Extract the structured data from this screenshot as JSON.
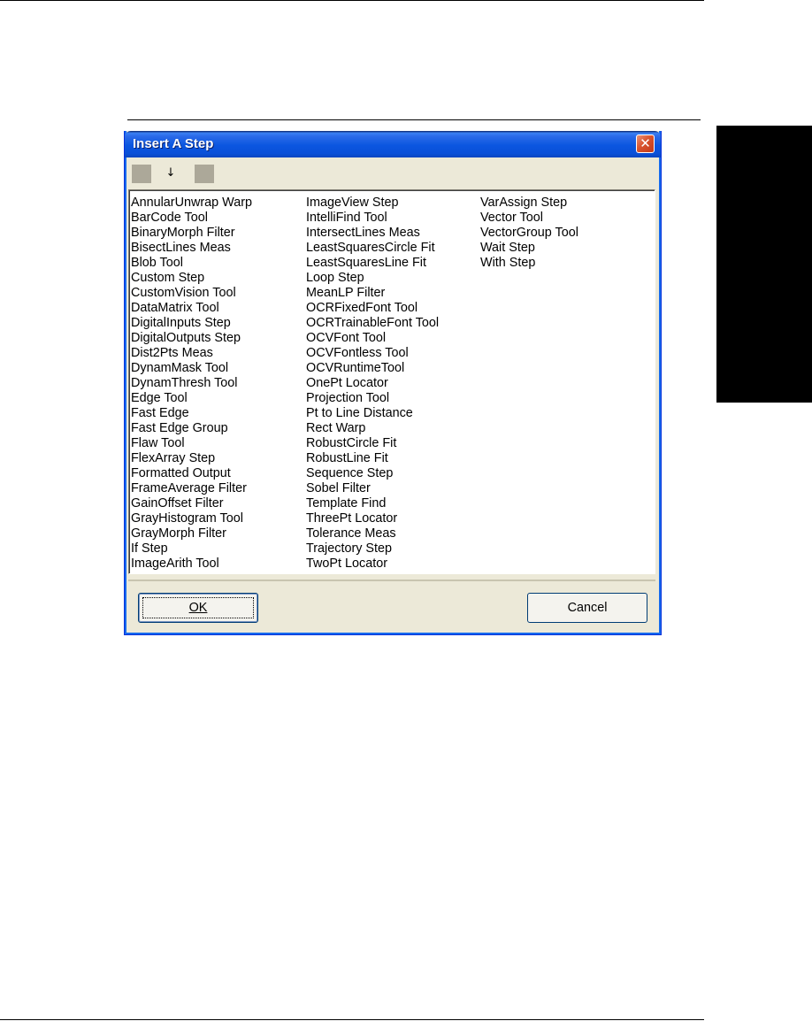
{
  "dialog": {
    "title": "Insert A Step",
    "close_glyph": "✕",
    "toolbar": {
      "down_glyph": "↓"
    },
    "ok_label": "OK",
    "cancel_label": "Cancel"
  },
  "steps": {
    "col1": [
      "AnnularUnwrap Warp",
      "BarCode Tool",
      "BinaryMorph Filter",
      "BisectLines Meas",
      "Blob Tool",
      "Custom Step",
      "CustomVision Tool",
      "DataMatrix Tool",
      "DigitalInputs Step",
      "DigitalOutputs Step",
      "Dist2Pts Meas",
      "DynamMask Tool",
      "DynamThresh Tool",
      "Edge Tool",
      "Fast Edge",
      "Fast Edge Group",
      "Flaw Tool",
      "FlexArray Step",
      "Formatted Output",
      "FrameAverage Filter",
      "GainOffset Filter",
      "GrayHistogram Tool",
      "GrayMorph Filter",
      "If Step",
      "ImageArith Tool"
    ],
    "col2": [
      "ImageView Step",
      "IntelliFind Tool",
      "IntersectLines Meas",
      "LeastSquaresCircle Fit",
      "LeastSquaresLine Fit",
      "Loop Step",
      "MeanLP Filter",
      "OCRFixedFont Tool",
      "OCRTrainableFont Tool",
      "OCVFont Tool",
      "OCVFontless Tool",
      "OCVRuntimeTool",
      "OnePt Locator",
      "Projection Tool",
      "Pt to Line Distance",
      "Rect Warp",
      "RobustCircle Fit",
      "RobustLine Fit",
      "Sequence Step",
      "Sobel Filter",
      "Template Find",
      "ThreePt Locator",
      "Tolerance Meas",
      "Trajectory Step",
      "TwoPt Locator"
    ],
    "col3": [
      "VarAssign Step",
      "Vector Tool",
      "VectorGroup Tool",
      "Wait Step",
      "With Step"
    ]
  }
}
